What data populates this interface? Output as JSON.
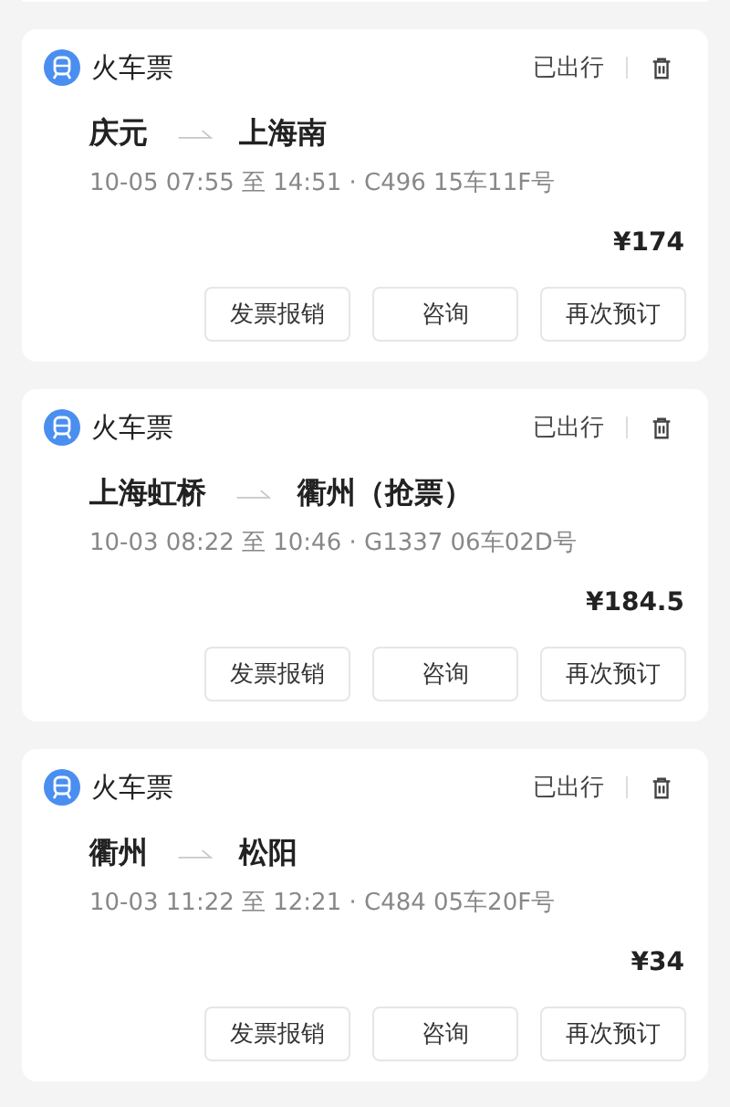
{
  "orders": [
    {
      "category": "火车票",
      "status": "已出行",
      "from": "庆元",
      "to": "上海南",
      "details": "10-05 07:55 至 14:51 · C496 15车11F号",
      "price": "¥174",
      "actions": [
        "发票报销",
        "咨询",
        "再次预订"
      ]
    },
    {
      "category": "火车票",
      "status": "已出行",
      "from": "上海虹桥",
      "to": "衢州（抢票）",
      "details": "10-03 08:22 至 10:46 · G1337 06车02D号",
      "price": "¥184.5",
      "actions": [
        "发票报销",
        "咨询",
        "再次预订"
      ]
    },
    {
      "category": "火车票",
      "status": "已出行",
      "from": "衢州",
      "to": "松阳",
      "details": "10-03 11:22 至 12:21 · C484 05车20F号",
      "price": "¥34",
      "actions": [
        "发票报销",
        "咨询",
        "再次预订"
      ]
    }
  ]
}
